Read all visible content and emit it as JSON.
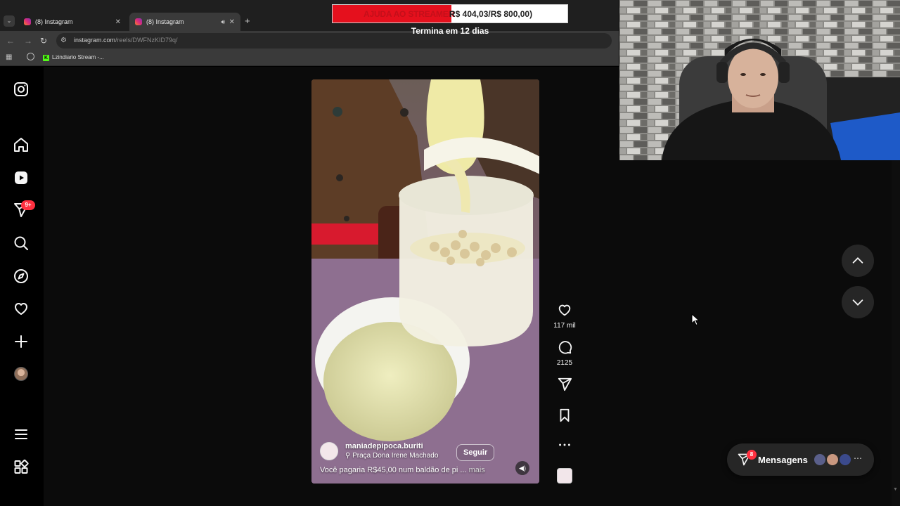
{
  "browser": {
    "tabs": [
      {
        "title": "(8) Instagram",
        "active": false
      },
      {
        "title": "(8) Instagram",
        "active": true
      }
    ],
    "url_domain": "instagram.com",
    "url_path": "/reels/DWFNzKID79q/",
    "bookmark": "Lzindiario Stream -..."
  },
  "overlay": {
    "donation_label": "AJUDA AO STREAMER",
    "donation_amount": "R$ 404,03/R$ 800,00)",
    "progress": 0.505,
    "ends_text": "Termina em 12 dias",
    "fill_color": "#e5101d"
  },
  "sidebar": {
    "items": [
      {
        "name": "instagram-logo-icon"
      },
      {
        "name": "home-icon"
      },
      {
        "name": "reels-icon"
      },
      {
        "name": "messages-icon"
      },
      {
        "name": "search-icon"
      },
      {
        "name": "explore-icon"
      },
      {
        "name": "notifications-icon"
      },
      {
        "name": "create-icon"
      },
      {
        "name": "profile-avatar"
      },
      {
        "name": "menu-icon"
      },
      {
        "name": "more-apps-icon"
      }
    ],
    "notification_badge": "9+"
  },
  "reel": {
    "username": "maniadepipoca.buriti",
    "location": "Praça Dona Irene Machado",
    "follow_label": "Seguir",
    "caption": "Você pagaria R$45,00 num baldão de pi ...",
    "more_label": "mais"
  },
  "actions": {
    "likes": "117 mil",
    "comments": "2125"
  },
  "messages": {
    "label": "Mensagens",
    "badge": "8"
  },
  "colors": {
    "ig_background": "#0b0b0b",
    "badge_red": "#ff3040"
  }
}
